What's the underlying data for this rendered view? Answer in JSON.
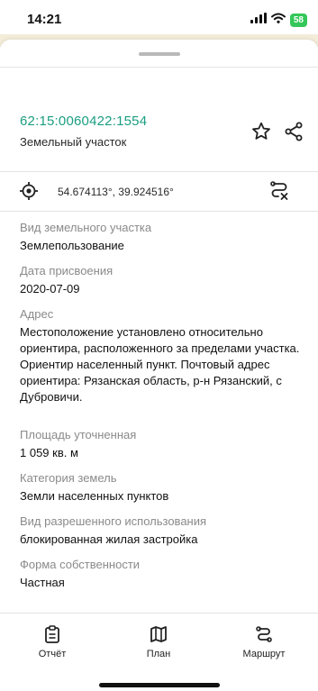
{
  "status_bar": {
    "time": "14:21",
    "battery": "58"
  },
  "header": {
    "cadastral_number": "62:15:0060422:1554",
    "object_type": "Земельный участок"
  },
  "coordinates": {
    "text": "54.674113°, 39.924516°"
  },
  "fields": [
    {
      "label": "Вид земельного участка",
      "value": "Землепользование"
    },
    {
      "label": "Дата присвоения",
      "value": "2020-07-09"
    },
    {
      "label": "Адрес",
      "value": "Местоположение установлено относительно ориентира, расположенного за пределами участка. Ориентир населенный пункт. Почтовый адрес ориентира: Рязанская область, р-н Рязанский, с Дубровичи."
    },
    {
      "label": "Площадь уточненная",
      "value": "1 059 кв. м"
    },
    {
      "label": "Категория земель",
      "value": "Земли населенных пунктов"
    },
    {
      "label": "Вид разрешенного использования",
      "value": "блокированная жилая застройка"
    },
    {
      "label": "Форма собственности",
      "value": "Частная"
    }
  ],
  "tabs": [
    {
      "label": "Отчёт"
    },
    {
      "label": "План"
    },
    {
      "label": "Маршрут"
    }
  ],
  "colors": {
    "accent": "#1a9e82",
    "label": "#8a8a8a",
    "battery": "#34c759"
  },
  "icons": [
    "signal-icon",
    "wifi-icon",
    "star-icon",
    "share-icon",
    "locate-icon",
    "route-off-icon",
    "report-icon",
    "map-icon",
    "route-icon"
  ]
}
